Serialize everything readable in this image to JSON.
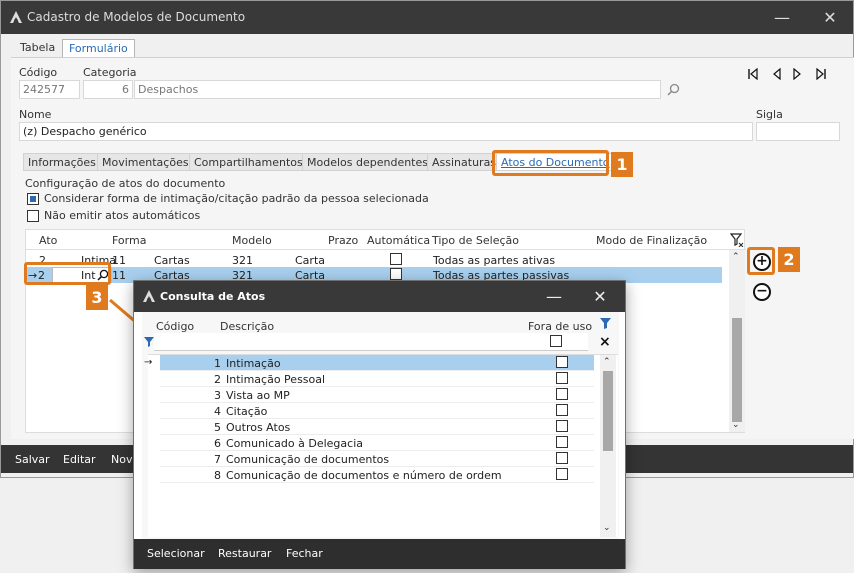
{
  "window": {
    "title": "Cadastro de Modelos de Documento",
    "minimize": "—",
    "close": "✕"
  },
  "top_tabs": [
    {
      "label": "Tabela"
    },
    {
      "label": "Formulário"
    }
  ],
  "form": {
    "codigo_label": "Código",
    "codigo_value": "242577",
    "categoria_label": "Categoria",
    "categoria_code": "6",
    "categoria_value": "Despachos",
    "nome_label": "Nome",
    "nome_value": "(z) Despacho genérico",
    "sigla_label": "Sigla",
    "sigla_value": ""
  },
  "doc_tabs": [
    {
      "label": "Informações"
    },
    {
      "label": "Movimentações"
    },
    {
      "label": "Compartilhamentos"
    },
    {
      "label": "Modelos dependentes"
    },
    {
      "label": "Assinaturas"
    },
    {
      "label": "Atos do Documento"
    }
  ],
  "config": {
    "heading": "Configuração de atos do documento",
    "option1": "Considerar forma de intimação/citação padrão da pessoa selecionada",
    "option1_checked": true,
    "option2": "Não emitir atos automáticos",
    "option2_checked": false
  },
  "grid": {
    "headers": [
      "Ato",
      "Forma",
      "Modelo",
      "Prazo",
      "Automática",
      "Tipo de Seleção",
      "Modo de Finalização"
    ],
    "rows": [
      {
        "ato": "2",
        "ato_text": "Intima",
        "forma_code": "11",
        "forma": "Cartas",
        "modelo": "321",
        "prazo": "Carta",
        "tipo": "Todas as partes ativas"
      },
      {
        "ato": "2",
        "ato_text": "Int",
        "forma_code": "11",
        "forma": "Cartas",
        "modelo": "321",
        "prazo": "Carta",
        "tipo": "Todas as partes passivas"
      }
    ]
  },
  "bottom_bar": [
    {
      "label": "Salvar"
    },
    {
      "label": "Editar"
    },
    {
      "label": "Novo"
    }
  ],
  "callouts": [
    "1",
    "2",
    "3"
  ],
  "dialog": {
    "title": "Consulta de Atos",
    "minimize": "—",
    "close": "✕",
    "headers": {
      "codigo": "Código",
      "descricao": "Descrição",
      "fora": "Fora de uso"
    },
    "clear": "×",
    "rows": [
      {
        "codigo": "1",
        "descricao": "Intimação"
      },
      {
        "codigo": "2",
        "descricao": "Intimação Pessoal"
      },
      {
        "codigo": "3",
        "descricao": "Vista ao MP"
      },
      {
        "codigo": "4",
        "descricao": "Citação"
      },
      {
        "codigo": "5",
        "descricao": "Outros Atos"
      },
      {
        "codigo": "6",
        "descricao": "Comunicado à Delegacia"
      },
      {
        "codigo": "7",
        "descricao": "Comunicação de documentos"
      },
      {
        "codigo": "8",
        "descricao": "Comunicação de documentos e número de ordem"
      }
    ],
    "footer": [
      {
        "label": "Selecionar"
      },
      {
        "label": "Restaurar"
      },
      {
        "label": "Fechar"
      }
    ]
  },
  "colors": {
    "accent": "#2b6ab3",
    "callout": "#e07a1f",
    "selection": "#a8d0ee",
    "titlebar": "#393939"
  }
}
